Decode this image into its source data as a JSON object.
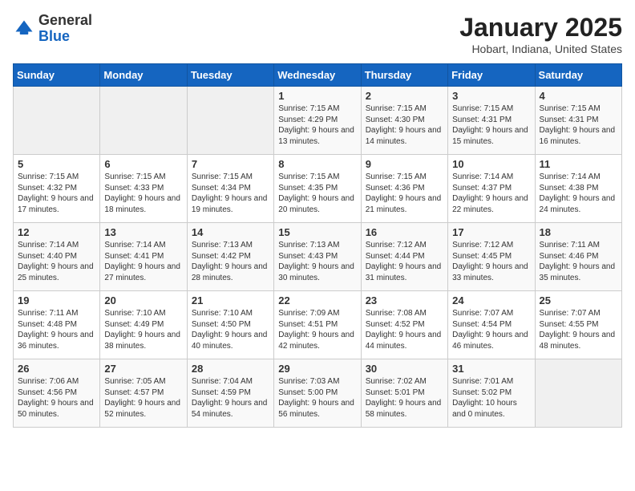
{
  "logo": {
    "general": "General",
    "blue": "Blue"
  },
  "header": {
    "month_year": "January 2025",
    "location": "Hobart, Indiana, United States"
  },
  "days_of_week": [
    "Sunday",
    "Monday",
    "Tuesday",
    "Wednesday",
    "Thursday",
    "Friday",
    "Saturday"
  ],
  "weeks": [
    [
      {
        "day": "",
        "empty": true
      },
      {
        "day": "",
        "empty": true
      },
      {
        "day": "",
        "empty": true
      },
      {
        "day": "1",
        "sunrise": "7:15 AM",
        "sunset": "4:29 PM",
        "daylight": "9 hours and 13 minutes."
      },
      {
        "day": "2",
        "sunrise": "7:15 AM",
        "sunset": "4:30 PM",
        "daylight": "9 hours and 14 minutes."
      },
      {
        "day": "3",
        "sunrise": "7:15 AM",
        "sunset": "4:31 PM",
        "daylight": "9 hours and 15 minutes."
      },
      {
        "day": "4",
        "sunrise": "7:15 AM",
        "sunset": "4:31 PM",
        "daylight": "9 hours and 16 minutes."
      }
    ],
    [
      {
        "day": "5",
        "sunrise": "7:15 AM",
        "sunset": "4:32 PM",
        "daylight": "9 hours and 17 minutes."
      },
      {
        "day": "6",
        "sunrise": "7:15 AM",
        "sunset": "4:33 PM",
        "daylight": "9 hours and 18 minutes."
      },
      {
        "day": "7",
        "sunrise": "7:15 AM",
        "sunset": "4:34 PM",
        "daylight": "9 hours and 19 minutes."
      },
      {
        "day": "8",
        "sunrise": "7:15 AM",
        "sunset": "4:35 PM",
        "daylight": "9 hours and 20 minutes."
      },
      {
        "day": "9",
        "sunrise": "7:15 AM",
        "sunset": "4:36 PM",
        "daylight": "9 hours and 21 minutes."
      },
      {
        "day": "10",
        "sunrise": "7:14 AM",
        "sunset": "4:37 PM",
        "daylight": "9 hours and 22 minutes."
      },
      {
        "day": "11",
        "sunrise": "7:14 AM",
        "sunset": "4:38 PM",
        "daylight": "9 hours and 24 minutes."
      }
    ],
    [
      {
        "day": "12",
        "sunrise": "7:14 AM",
        "sunset": "4:40 PM",
        "daylight": "9 hours and 25 minutes."
      },
      {
        "day": "13",
        "sunrise": "7:14 AM",
        "sunset": "4:41 PM",
        "daylight": "9 hours and 27 minutes."
      },
      {
        "day": "14",
        "sunrise": "7:13 AM",
        "sunset": "4:42 PM",
        "daylight": "9 hours and 28 minutes."
      },
      {
        "day": "15",
        "sunrise": "7:13 AM",
        "sunset": "4:43 PM",
        "daylight": "9 hours and 30 minutes."
      },
      {
        "day": "16",
        "sunrise": "7:12 AM",
        "sunset": "4:44 PM",
        "daylight": "9 hours and 31 minutes."
      },
      {
        "day": "17",
        "sunrise": "7:12 AM",
        "sunset": "4:45 PM",
        "daylight": "9 hours and 33 minutes."
      },
      {
        "day": "18",
        "sunrise": "7:11 AM",
        "sunset": "4:46 PM",
        "daylight": "9 hours and 35 minutes."
      }
    ],
    [
      {
        "day": "19",
        "sunrise": "7:11 AM",
        "sunset": "4:48 PM",
        "daylight": "9 hours and 36 minutes."
      },
      {
        "day": "20",
        "sunrise": "7:10 AM",
        "sunset": "4:49 PM",
        "daylight": "9 hours and 38 minutes."
      },
      {
        "day": "21",
        "sunrise": "7:10 AM",
        "sunset": "4:50 PM",
        "daylight": "9 hours and 40 minutes."
      },
      {
        "day": "22",
        "sunrise": "7:09 AM",
        "sunset": "4:51 PM",
        "daylight": "9 hours and 42 minutes."
      },
      {
        "day": "23",
        "sunrise": "7:08 AM",
        "sunset": "4:52 PM",
        "daylight": "9 hours and 44 minutes."
      },
      {
        "day": "24",
        "sunrise": "7:07 AM",
        "sunset": "4:54 PM",
        "daylight": "9 hours and 46 minutes."
      },
      {
        "day": "25",
        "sunrise": "7:07 AM",
        "sunset": "4:55 PM",
        "daylight": "9 hours and 48 minutes."
      }
    ],
    [
      {
        "day": "26",
        "sunrise": "7:06 AM",
        "sunset": "4:56 PM",
        "daylight": "9 hours and 50 minutes."
      },
      {
        "day": "27",
        "sunrise": "7:05 AM",
        "sunset": "4:57 PM",
        "daylight": "9 hours and 52 minutes."
      },
      {
        "day": "28",
        "sunrise": "7:04 AM",
        "sunset": "4:59 PM",
        "daylight": "9 hours and 54 minutes."
      },
      {
        "day": "29",
        "sunrise": "7:03 AM",
        "sunset": "5:00 PM",
        "daylight": "9 hours and 56 minutes."
      },
      {
        "day": "30",
        "sunrise": "7:02 AM",
        "sunset": "5:01 PM",
        "daylight": "9 hours and 58 minutes."
      },
      {
        "day": "31",
        "sunrise": "7:01 AM",
        "sunset": "5:02 PM",
        "daylight": "10 hours and 0 minutes."
      },
      {
        "day": "",
        "empty": true
      }
    ]
  ]
}
